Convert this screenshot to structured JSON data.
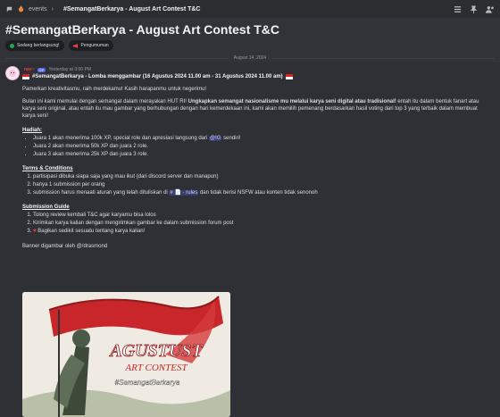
{
  "topbar": {
    "events_label": "events",
    "title": "#SemangatBerkarya - August Art Contest T&C"
  },
  "header": {
    "title": "#SemangatBerkarya - August Art Contest T&C",
    "tags": [
      {
        "label": "Sedang berlangsung!",
        "color": "#23a55a"
      },
      {
        "label": "Pengumuman",
        "color": "#f23f43"
      }
    ]
  },
  "date_divider": "August 14, 2024",
  "message": {
    "username": "nav~",
    "badge": "OP",
    "timestamp": "Yesterday at 3:06 PM",
    "heading": "#SemangatBerkarya - Lomba menggambar (16 Agustus 2024 11.00 am - 31 Agustus 2024 11.00 am)",
    "intro": "Pamerkan kreativitasmu, raih merdekamu! Kasih harapanmu untuk negerimu!",
    "para_a": "Bulan ini kami memulai dengan semangat dalam merayakan HUT RI!",
    "para_b": "Ungkapkan semangat nasionalisme mu melalui karya seni digital atau tradisional!",
    "para_c": "entah itu dalam bentuk fanart atau karya seni original, atau entah itu mau gambar yang berhubungan dengan hari kemerdekaan ini, kami akan memilih pemenang berdasarkan hasil voting dari top 3 yang terbaik dalam membuat karya seni!",
    "hadiah_title": "Hadiah",
    "hadiah": [
      {
        "pre": "Juara 1 akan menerima 100k XP, special role dan apresiasi langsung dari ",
        "mention": "@IG",
        "post": " sendiri!"
      },
      {
        "pre": "Juara 2 akan menerima 50k XP dan juara 2 role.",
        "mention": "",
        "post": ""
      },
      {
        "pre": "Juara 3 akan menerima 25k XP dan juara 3 role.",
        "mention": "",
        "post": ""
      }
    ],
    "terms_title": "Terms & Conditions",
    "terms": [
      "partisipasi dibuka siapa saja yang mau ikut (dari discord server dan manapun)",
      "hanya 1 submission per orang"
    ],
    "term3_pre": "submission harus menaati aturan yang telah dituliskan di",
    "term3_channel": "rules",
    "term3_post": "dan tidak berisi NSFW atau konten tidak senonoh",
    "submission_title": "Submission Guide",
    "submission": [
      "Tolong review kembali T&C agar karyamu bisa lolos",
      "Kirimkan karya kalian dengan mengirimkan gambar ke dalam submission forum post",
      "Bagikan sedikit sesuatu tentang karya kalian!"
    ],
    "banner_credit": "Banner digambar oleh @/drasmond",
    "banner_title": "AGUSTUST",
    "banner_sub": "ART CONTEST",
    "banner_tag": "#SemangatBerkarya"
  }
}
